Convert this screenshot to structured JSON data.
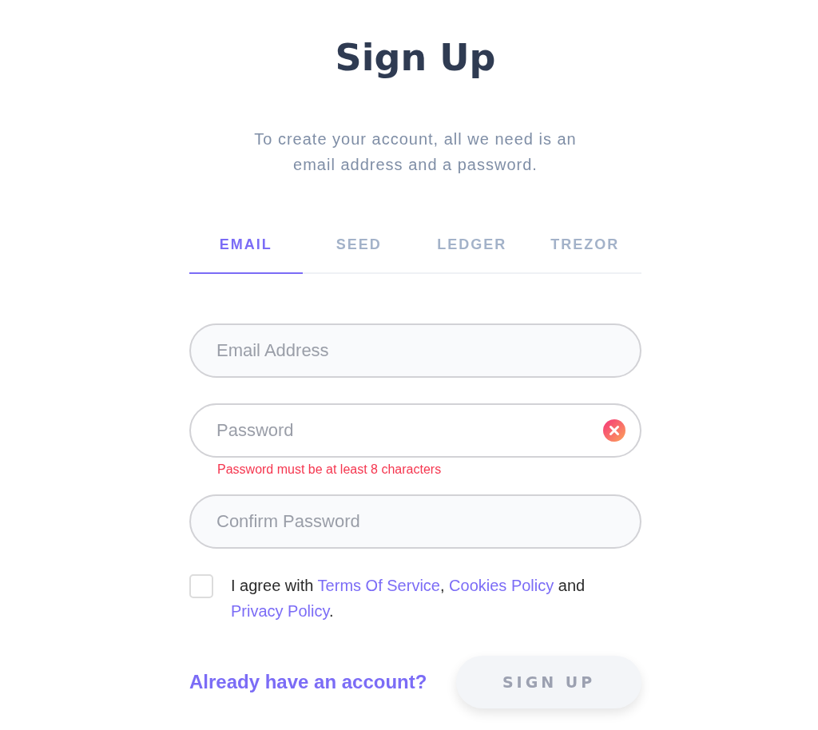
{
  "title": "Sign Up",
  "subtitle": "To create your account, all we need is an email address and a password.",
  "tabs": [
    {
      "label": "EMAIL",
      "selected": true
    },
    {
      "label": "SEED",
      "selected": false
    },
    {
      "label": "LEDGER",
      "selected": false
    },
    {
      "label": "TREZOR",
      "selected": false
    }
  ],
  "fields": [
    {
      "placeholder": "Email Address"
    },
    {
      "placeholder": "Password",
      "error": "Password must be at least 8 characters"
    },
    {
      "placeholder": "Confirm Password"
    }
  ],
  "agreement": {
    "checked": false,
    "parts": [
      {
        "kind": "text",
        "text": "I agree with "
      },
      {
        "kind": "link",
        "text": "Terms Of Service"
      },
      {
        "kind": "text",
        "text": ", "
      },
      {
        "kind": "link",
        "text": "Cookies Policy"
      },
      {
        "kind": "text",
        "text": " and "
      },
      {
        "kind": "link",
        "text": "Privacy Policy"
      },
      {
        "kind": "text",
        "text": "."
      }
    ]
  },
  "login_link": "Already have an account?",
  "submit": {
    "label": "SIGN UP",
    "disabled": true
  }
}
